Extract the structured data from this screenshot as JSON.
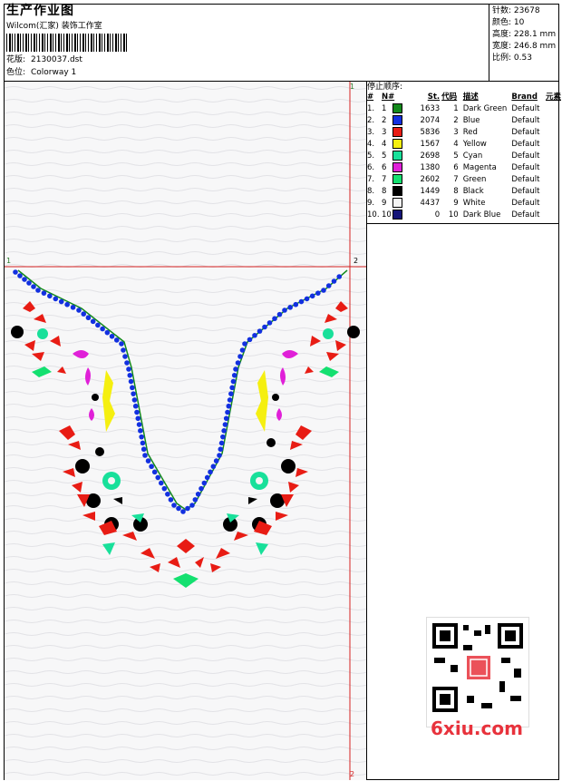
{
  "header": {
    "title": "生产作业图",
    "company": "Wilcom(汇家) 装饰工作室",
    "design_label": "花版:",
    "design_value": "2130037.dst",
    "colorway_label": "色位:",
    "colorway_value": "Colorway 1"
  },
  "stats": {
    "stitches_label": "针数:",
    "stitches": "23678",
    "colors_label": "颜色:",
    "colors": "10",
    "height_label": "高度:",
    "height": "228.1 mm",
    "width_label": "宽度:",
    "width": "246.8 mm",
    "scale_label": "比例:",
    "scale": "0.53"
  },
  "stop_sequence": {
    "title": "停止顺序:",
    "headers": [
      "#",
      "N#",
      "St.",
      "代码",
      "描述",
      "Brand",
      "元素"
    ],
    "rows": [
      {
        "idx": "1.",
        "n": "1",
        "st": "1633",
        "code": "1",
        "desc": "Dark Green",
        "brand": "Default",
        "color": "#138a1c"
      },
      {
        "idx": "2.",
        "n": "2",
        "st": "2074",
        "code": "2",
        "desc": "Blue",
        "brand": "Default",
        "color": "#1230e0"
      },
      {
        "idx": "3.",
        "n": "3",
        "st": "5836",
        "code": "3",
        "desc": "Red",
        "brand": "Default",
        "color": "#e81c14"
      },
      {
        "idx": "4.",
        "n": "4",
        "st": "1567",
        "code": "4",
        "desc": "Yellow",
        "brand": "Default",
        "color": "#f5ef10"
      },
      {
        "idx": "5.",
        "n": "5",
        "st": "2698",
        "code": "5",
        "desc": "Cyan",
        "brand": "Default",
        "color": "#18e09a"
      },
      {
        "idx": "6.",
        "n": "6",
        "st": "1380",
        "code": "6",
        "desc": "Magenta",
        "brand": "Default",
        "color": "#e020d8"
      },
      {
        "idx": "7.",
        "n": "7",
        "st": "2602",
        "code": "7",
        "desc": "Green",
        "brand": "Default",
        "color": "#14e070"
      },
      {
        "idx": "8.",
        "n": "8",
        "st": "1449",
        "code": "8",
        "desc": "Black",
        "brand": "Default",
        "color": "#000000"
      },
      {
        "idx": "9.",
        "n": "9",
        "st": "4437",
        "code": "9",
        "desc": "White",
        "brand": "Default",
        "color": "#f4f4f4"
      },
      {
        "idx": "10.",
        "n": "10",
        "st": "0",
        "code": "10",
        "desc": "Dark Blue",
        "brand": "Default",
        "color": "#141478"
      }
    ]
  },
  "design": {
    "marker_1": "1",
    "marker_2": "2"
  },
  "watermark": "6xiu.com"
}
